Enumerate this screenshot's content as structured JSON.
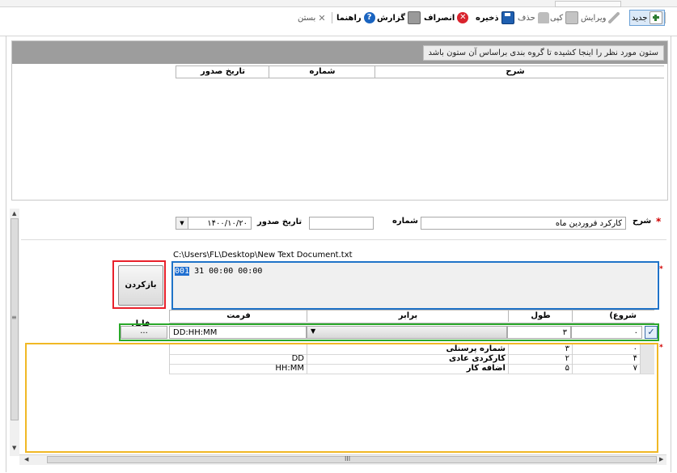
{
  "toolbar": {
    "new": "جدید",
    "edit": "ویرایش",
    "copy": "کپی",
    "delete": "حذف",
    "save": "ذخیره",
    "cancel": "انصراف",
    "report": "گزارش",
    "help": "راهنما",
    "close": "بستن"
  },
  "group_panel": {
    "hint": "ستون مورد نظر را اینجا کشیده تا گروه بندی براساس آن ستون باشد",
    "columns": [
      "شرح",
      "شماره",
      "تاریخ صدور"
    ]
  },
  "form": {
    "description_label": "شرح",
    "description_value": "کارکرد فروردین ماه",
    "number_label": "شماره",
    "number_value": "",
    "issue_date_label": "تاریخ صدور",
    "issue_date_value": "۱۴۰۰/۱۰/۲۰"
  },
  "file": {
    "path": "C:\\Users\\FL\\Desktop\\New Text Document.txt",
    "load_button": "بازکردن فایل",
    "content_highlight": "001",
    "content_rest": " 31 00:00 00:00"
  },
  "mapping": {
    "headers": {
      "start": "(شروع",
      "length": "طول",
      "equal": "برابر",
      "format": "فرمت"
    },
    "editor": {
      "start": "۰",
      "length": "۳",
      "equal": "",
      "format": "DD:HH:MM",
      "browse": "..."
    },
    "rows": [
      {
        "start": "۰",
        "length": "۳",
        "equal": "شماره پرسنلی",
        "format": ""
      },
      {
        "start": "۴",
        "length": "۲",
        "equal": "کارکردی عادی",
        "format": "DD"
      },
      {
        "start": "۷",
        "length": "۵",
        "equal": "اضافه کار",
        "format": "HH:MM"
      }
    ]
  },
  "scrollbar": {
    "grip": "III"
  }
}
